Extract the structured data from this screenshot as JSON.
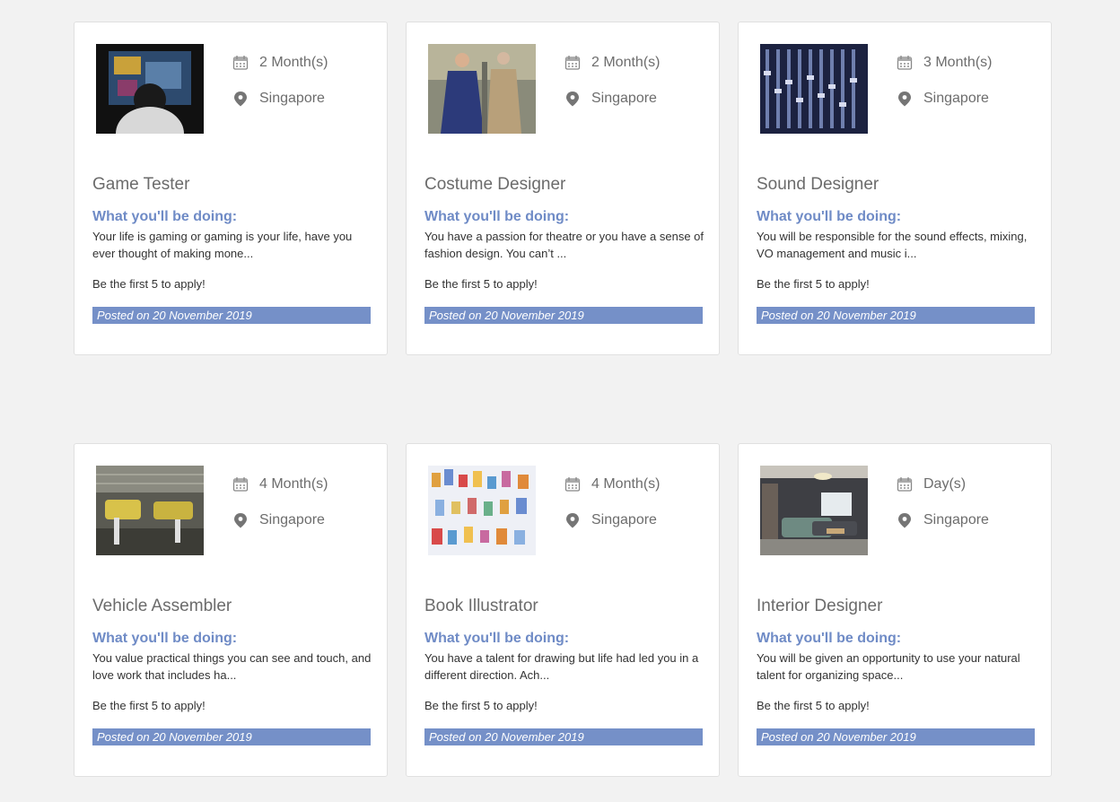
{
  "cards": [
    {
      "duration": "2 Month(s)",
      "location": "Singapore",
      "title": "Game Tester",
      "heading": "What you'll be doing:",
      "description": "Your life is gaming or gaming is your life, have you ever thought of making mone...",
      "apply": "Be the first 5 to apply!",
      "posted": "Posted on 20 November 2019",
      "image": "gamer-photo"
    },
    {
      "duration": "2 Month(s)",
      "location": "Singapore",
      "title": "Costume Designer",
      "heading": "What you'll be doing:",
      "description": "You have a passion for theatre or you have a sense of fashion design. You can’t ...",
      "apply": "Be the first 5 to apply!",
      "posted": "Posted on 20 November 2019",
      "image": "costume-photo"
    },
    {
      "duration": "3 Month(s)",
      "location": "Singapore",
      "title": "Sound Designer",
      "heading": "What you'll be doing:",
      "description": "You will be responsible for the sound effects, mixing, VO management and music i...",
      "apply": "Be the first 5 to apply!",
      "posted": "Posted on 20 November 2019",
      "image": "mixer-photo"
    },
    {
      "duration": "4 Month(s)",
      "location": "Singapore",
      "title": "Vehicle Assembler",
      "heading": "What you'll be doing:",
      "description": "You value practical things you can see and touch, and love work that includes ha...",
      "apply": "Be the first 5 to apply!",
      "posted": "Posted on 20 November 2019",
      "image": "factory-photo"
    },
    {
      "duration": "4 Month(s)",
      "location": "Singapore",
      "title": "Book Illustrator",
      "heading": "What you'll be doing:",
      "description": "You have a talent for drawing but life had led you in a different direction. Ach...",
      "apply": "Be the first 5 to apply!",
      "posted": "Posted on 20 November 2019",
      "image": "illustration-photo"
    },
    {
      "duration": "Day(s)",
      "location": "Singapore",
      "title": "Interior Designer",
      "heading": "What you'll be doing:",
      "description": "You will be given an opportunity to use your natural talent for organizing space...",
      "apply": "Be the first 5 to apply!",
      "posted": "Posted on 20 November 2019",
      "image": "interior-photo"
    }
  ],
  "colors": {
    "accent": "#6f8bc6",
    "badge": "#7590c8",
    "background": "#f2f2f2"
  }
}
